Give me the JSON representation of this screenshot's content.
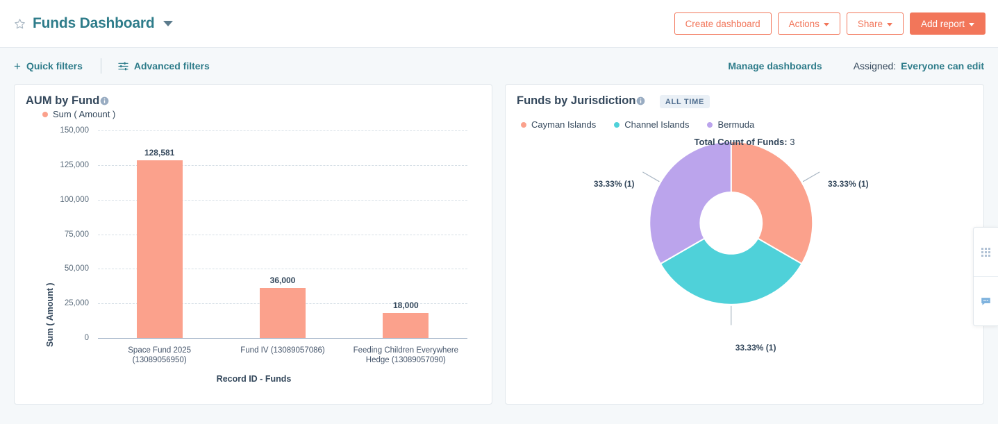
{
  "header": {
    "star_icon": "star-outline-icon",
    "title": "Funds Dashboard",
    "caret_icon": "chevron-down-icon",
    "buttons": {
      "create_dashboard": "Create dashboard",
      "actions": "Actions",
      "share": "Share",
      "add_report": "Add report"
    },
    "primary_color": "#F2765A",
    "title_color": "#2E7C8A"
  },
  "filterbar": {
    "plus_icon": "plus-icon",
    "quick_filters": "Quick filters",
    "sliders_icon": "sliders-icon",
    "advanced_filters": "Advanced filters",
    "manage_dashboards": "Manage dashboards",
    "assigned_label": "Assigned:",
    "assigned_value": "Everyone can edit"
  },
  "cards": [
    {
      "title": "AUM by Fund",
      "info_icon": "info-circle-icon",
      "legend": [
        {
          "label": "Sum ( Amount )",
          "color": "#FBA18C"
        }
      ]
    },
    {
      "title": "Funds by Jurisdiction",
      "info_icon": "info-circle-icon",
      "badge": "ALL TIME",
      "legend": [
        {
          "label": "Cayman Islands",
          "color": "#FBA18C"
        },
        {
          "label": "Channel Islands",
          "color": "#4FD1D9"
        },
        {
          "label": "Bermuda",
          "color": "#BBA4EC"
        }
      ]
    }
  ],
  "chart_data": [
    {
      "type": "bar",
      "title": "AUM by Fund",
      "xlabel": "Record ID - Funds",
      "ylabel": "Sum ( Amount )",
      "ylim": [
        0,
        150000
      ],
      "yticks": [
        "0",
        "25,000",
        "50,000",
        "75,000",
        "100,000",
        "125,000",
        "150,000"
      ],
      "ytick_values": [
        0,
        25000,
        50000,
        75000,
        100000,
        125000,
        150000
      ],
      "grid": true,
      "legend_position": "top-left",
      "series_name": "Sum ( Amount )",
      "bar_color": "#FBA18C",
      "categories": [
        "Space Fund 2025 (13089056950)",
        "Fund IV (13089057086)",
        "Feeding Children Everywhere Hedge (13089057090)"
      ],
      "category_lines": [
        [
          "Space Fund 2025",
          "(13089056950)"
        ],
        [
          "Fund IV (13089057086)",
          ""
        ],
        [
          "Feeding Children Everywhere",
          "Hedge (13089057090)"
        ]
      ],
      "values": [
        128581,
        36000,
        18000
      ],
      "value_labels": [
        "128,581",
        "36,000",
        "18,000"
      ]
    },
    {
      "type": "pie",
      "title": "Funds by Jurisdiction",
      "subtitle": "ALL TIME",
      "center_label_bold": "Total Count of Funds:",
      "center_label_value": "3",
      "total": 3,
      "donut": true,
      "legend_position": "top",
      "labels": [
        "Cayman Islands",
        "Channel Islands",
        "Bermuda"
      ],
      "values": [
        1,
        1,
        1
      ],
      "percentages": [
        "33.33%",
        "33.33%",
        "33.33%"
      ],
      "data_labels": [
        "33.33% (1)",
        "33.33% (1)",
        "33.33% (1)"
      ],
      "colors": [
        "#FBA18C",
        "#4FD1D9",
        "#BBA4EC"
      ]
    }
  ],
  "float_panel": {
    "grid_icon": "grid-drag-icon",
    "chat_icon": "chat-bubble-icon"
  }
}
